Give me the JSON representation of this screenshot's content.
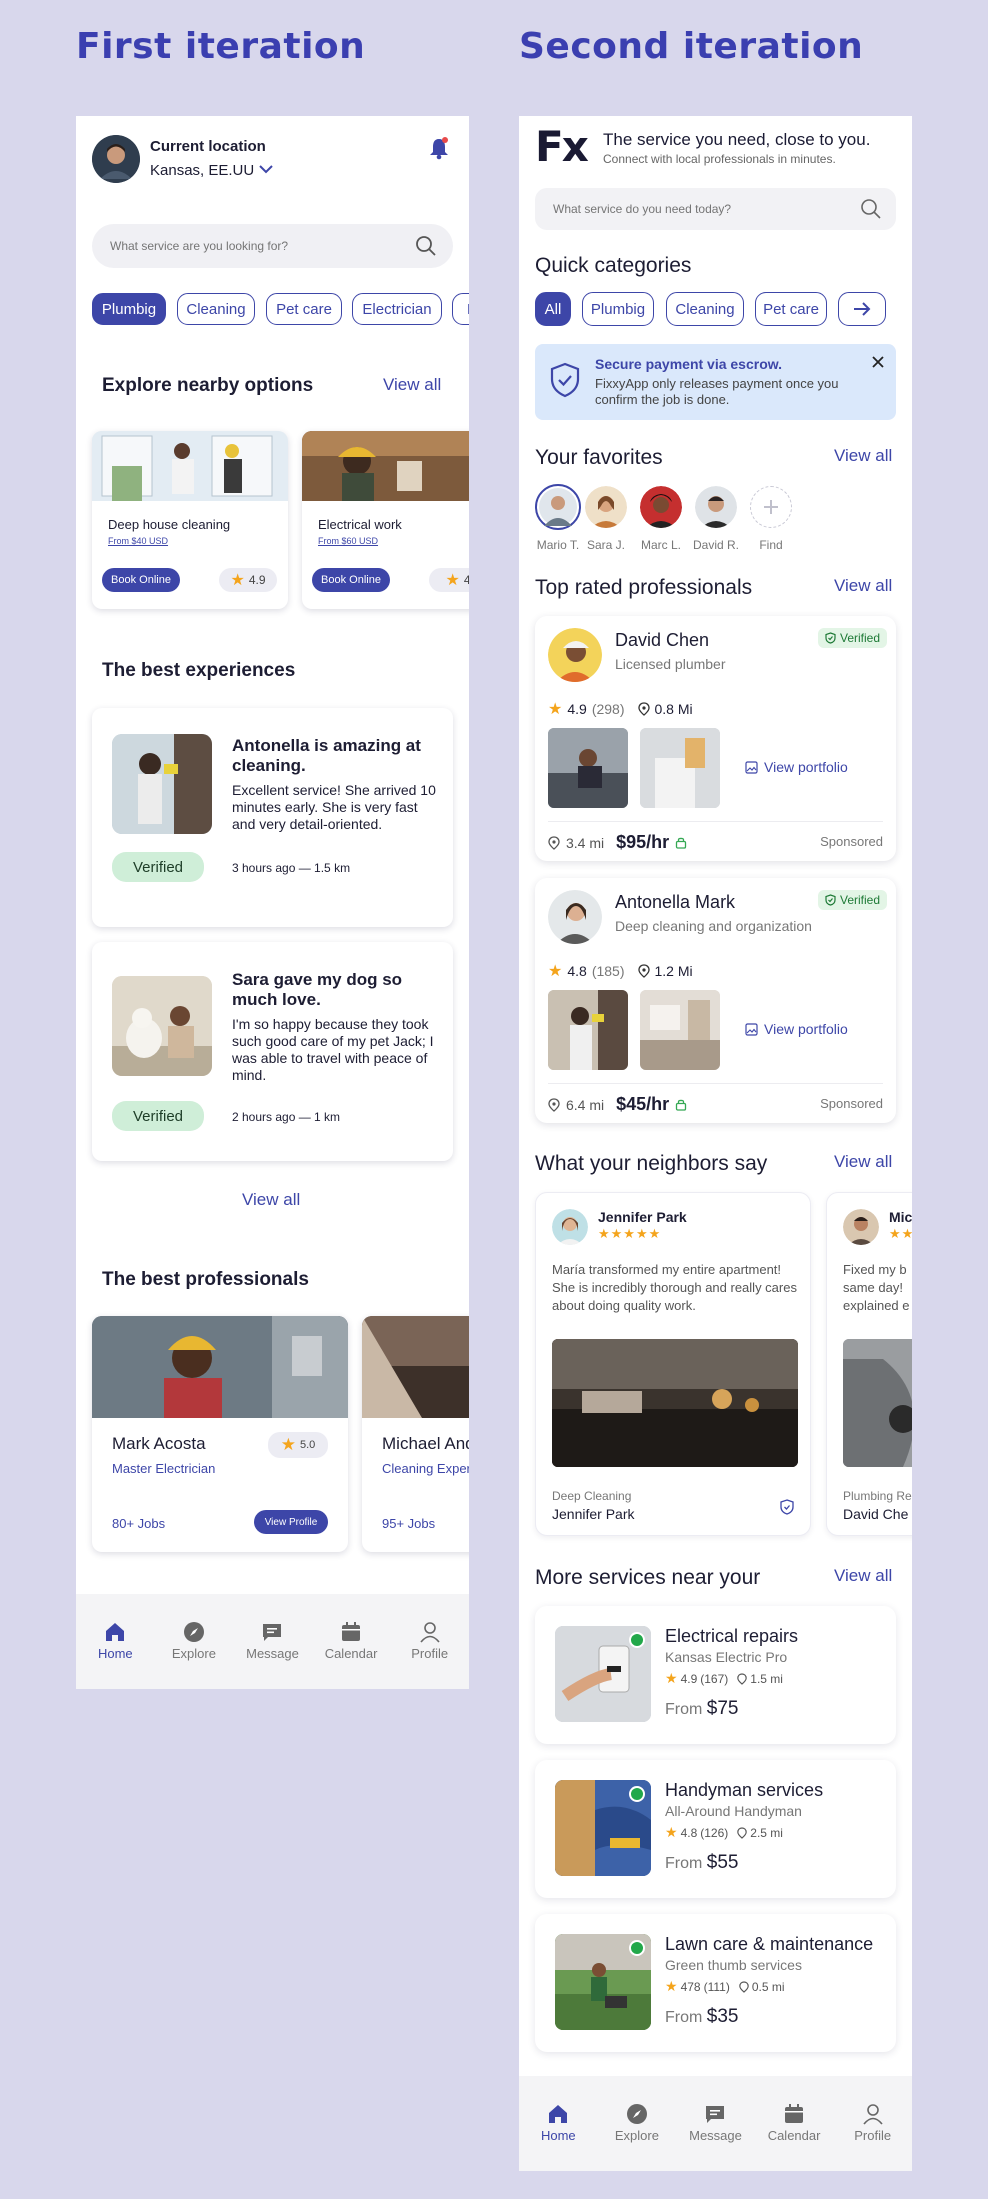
{
  "headings": {
    "first": "First iteration",
    "second": "Second iteration"
  },
  "v1": {
    "location_label": "Current location",
    "location_value": "Kansas, EE.UU",
    "search_placeholder": "What service are you looking for?",
    "chips": [
      "Plumbig",
      "Cleaning",
      "Pet care",
      "Electrician",
      "B"
    ],
    "nearby": {
      "title": "Explore nearby options",
      "view_all": "View all",
      "cards": [
        {
          "title": "Deep house cleaning",
          "price": "From $40 USD",
          "button": "Book Online",
          "rating": "4.9"
        },
        {
          "title": "Electrical work",
          "price": "From $60 USD",
          "button": "Book Online",
          "rating": "4"
        }
      ]
    },
    "experiences": {
      "title": "The best experiences",
      "items": [
        {
          "title": "Antonella is amazing at cleaning.",
          "text": "Excellent service! She arrived 10 minutes early. She is very fast and very detail-oriented.",
          "badge": "Verified",
          "meta": "3 hours ago — 1.5 km"
        },
        {
          "title": "Sara gave my dog so much love.",
          "text": "I'm so happy because they took such good care of my pet Jack; I was able to travel with peace of mind.",
          "badge": "Verified",
          "meta": "2 hours ago — 1 km"
        }
      ],
      "view_all": "View all"
    },
    "professionals": {
      "title": "The best professionals",
      "cards": [
        {
          "name": "Mark Acosta",
          "role": "Master Electrician",
          "rating": "5.0",
          "jobs": "80+ Jobs",
          "button": "View Profile"
        },
        {
          "name": "Michael And",
          "role": "Cleaning Exper",
          "jobs": "95+ Jobs"
        }
      ]
    },
    "nav": [
      "Home",
      "Explore",
      "Message",
      "Calendar",
      "Profile"
    ]
  },
  "v2": {
    "logo": "Fx",
    "tagline": "The service you need, close to you.",
    "subtagline": "Connect with local professionals in minutes.",
    "search_placeholder": "What service do you need today?",
    "quick_title": "Quick categories",
    "chips": [
      "All",
      "Plumbig",
      "Cleaning",
      "Pet care"
    ],
    "escrow": {
      "title": "Secure payment via escrow.",
      "text": "FixxyApp only releases payment once you confirm the job is done."
    },
    "favorites": {
      "title": "Your favorites",
      "view_all": "View all",
      "people": [
        "Mario T.",
        "Sara J.",
        "Marc L.",
        "David R.",
        "Find"
      ]
    },
    "top_rated": {
      "title": "Top rated professionals",
      "view_all": "View all",
      "pros": [
        {
          "name": "David Chen",
          "role": "Licensed plumber",
          "badge": "Verified",
          "rating": "4.9",
          "reviews": "(298)",
          "distance": "0.8 Mi",
          "portfolio": "View portfolio",
          "loc": "3.4 mi",
          "price": "$95/hr",
          "sponsored": "Sponsored"
        },
        {
          "name": "Antonella Mark",
          "role": "Deep cleaning and organization",
          "badge": "Verified",
          "rating": "4.8",
          "reviews": "(185)",
          "distance": "1.2 Mi",
          "portfolio": "View portfolio",
          "loc": "6.4 mi",
          "price": "$45/hr",
          "sponsored": "Sponsored"
        }
      ]
    },
    "neighbors": {
      "title": "What your neighbors say",
      "view_all": "View all",
      "reviews": [
        {
          "name": "Jennifer Park",
          "text": "María transformed my entire apartment! She is incredibly thorough and really cares about doing quality work.",
          "category": "Deep Cleaning",
          "author": "Jennifer Park"
        },
        {
          "name": "Mic",
          "text": "Fixed my b same day! explained e",
          "category": "Plumbing Re",
          "author": "David Che"
        }
      ]
    },
    "more": {
      "title": "More services near your",
      "view_all": "View all",
      "services": [
        {
          "title": "Electrical repairs",
          "provider": "Kansas Electric Pro",
          "rating": "4.9",
          "reviews": "(167)",
          "distance": "1.5 mi",
          "from": "From",
          "price": "$75"
        },
        {
          "title": "Handyman services",
          "provider": "All-Around Handyman",
          "rating": "4.8",
          "reviews": "(126)",
          "distance": "2.5 mi",
          "from": "From",
          "price": "$55"
        },
        {
          "title": "Lawn care & maintenance",
          "provider": "Green thumb services",
          "rating": "478",
          "reviews": "(111)",
          "distance": "0.5 mi",
          "from": "From",
          "price": "$35"
        }
      ]
    },
    "nav": [
      "Home",
      "Explore",
      "Message",
      "Calendar",
      "Profile"
    ]
  },
  "colors": {
    "accent": "#3d46a8",
    "background": "#d8d7ec",
    "verified": "#cfeed8",
    "star": "#f4a41c"
  }
}
